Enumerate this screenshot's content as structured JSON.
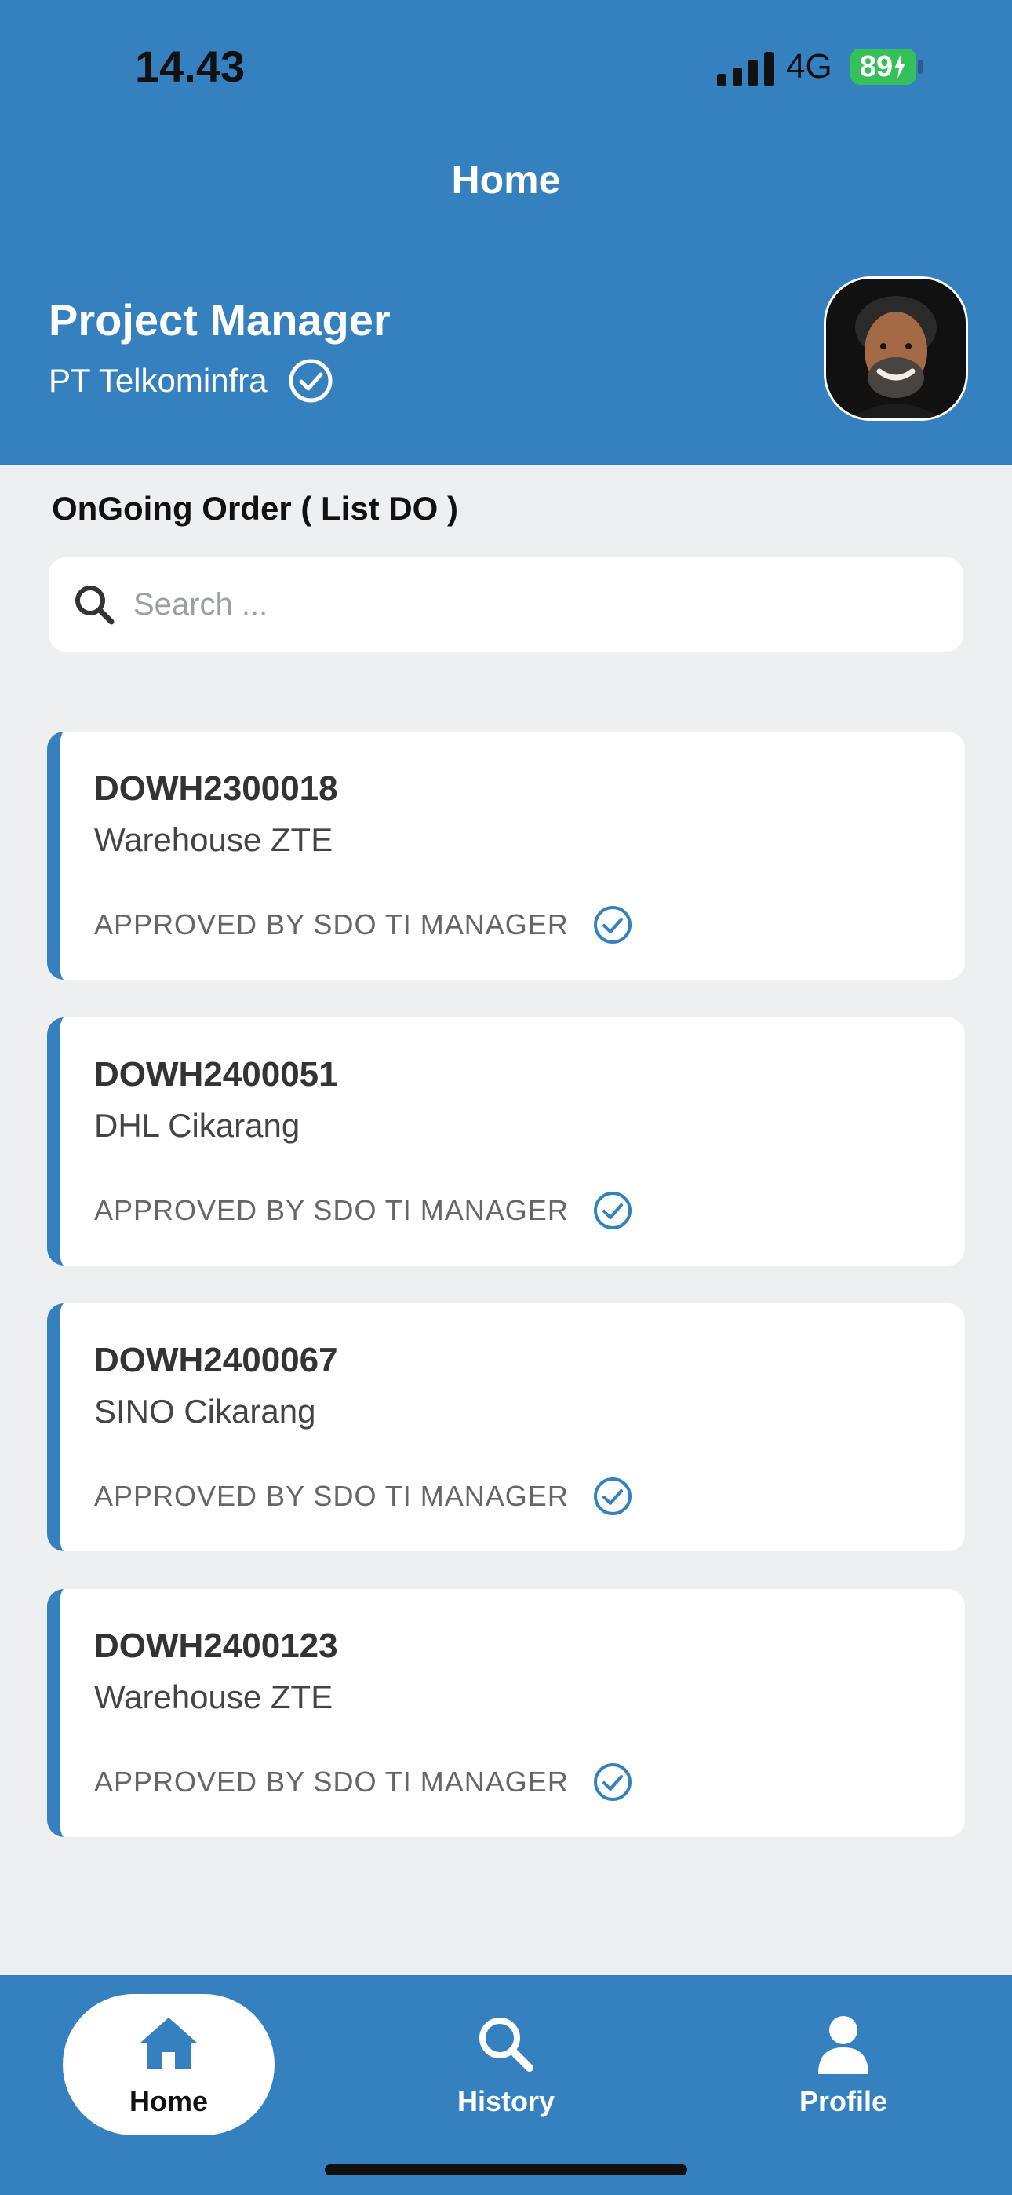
{
  "status_bar": {
    "time": "14.43",
    "network": "4G",
    "battery": "89"
  },
  "header": {
    "title": "Home",
    "role": "Project Manager",
    "company": "PT Telkominfra"
  },
  "orders": {
    "section_title": "OnGoing Order ( List DO )",
    "search_placeholder": "Search ...",
    "items": [
      {
        "code": "DOWH2300018",
        "location": "Warehouse ZTE",
        "status": "APPROVED BY SDO TI MANAGER"
      },
      {
        "code": "DOWH2400051",
        "location": "DHL Cikarang",
        "status": "APPROVED BY SDO TI MANAGER"
      },
      {
        "code": "DOWH2400067",
        "location": "SINO Cikarang",
        "status": "APPROVED BY SDO TI MANAGER"
      },
      {
        "code": "DOWH2400123",
        "location": "Warehouse ZTE",
        "status": "APPROVED BY SDO TI MANAGER"
      }
    ]
  },
  "nav": {
    "items": [
      {
        "label": "Home",
        "icon": "home-icon",
        "active": true
      },
      {
        "label": "History",
        "icon": "search-icon",
        "active": false
      },
      {
        "label": "Profile",
        "icon": "person-icon",
        "active": false
      }
    ]
  },
  "colors": {
    "primary": "#3580be",
    "background": "#eeeff1",
    "battery": "#36c05a"
  }
}
